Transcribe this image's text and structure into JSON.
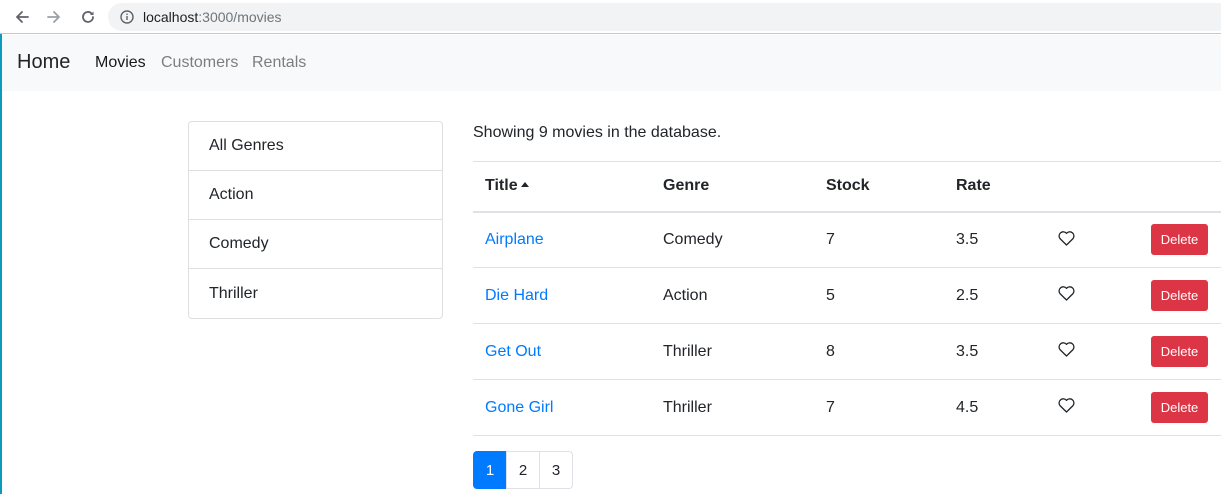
{
  "browser": {
    "url_host": "localhost",
    "url_path": ":3000/movies"
  },
  "navbar": {
    "brand": "Home",
    "links": [
      {
        "label": "Movies",
        "active": true
      },
      {
        "label": "Customers",
        "active": false
      },
      {
        "label": "Rentals",
        "active": false
      }
    ]
  },
  "genres": [
    "All Genres",
    "Action",
    "Comedy",
    "Thriller"
  ],
  "summary": "Showing 9 movies in the database.",
  "table": {
    "headers": {
      "title": "Title",
      "genre": "Genre",
      "stock": "Stock",
      "rate": "Rate"
    },
    "rows": [
      {
        "title": "Airplane",
        "genre": "Comedy",
        "stock": "7",
        "rate": "3.5",
        "delete": "Delete"
      },
      {
        "title": "Die Hard",
        "genre": "Action",
        "stock": "5",
        "rate": "2.5",
        "delete": "Delete"
      },
      {
        "title": "Get Out",
        "genre": "Thriller",
        "stock": "8",
        "rate": "3.5",
        "delete": "Delete"
      },
      {
        "title": "Gone Girl",
        "genre": "Thriller",
        "stock": "7",
        "rate": "4.5",
        "delete": "Delete"
      }
    ]
  },
  "pagination": {
    "pages": [
      "1",
      "2",
      "3"
    ],
    "current": "1"
  },
  "colors": {
    "primary": "#007bff",
    "danger": "#dc3545",
    "navbar_bg": "#f8f9fa"
  },
  "icons": {
    "back": "arrow-left-icon",
    "forward": "arrow-right-icon",
    "reload": "reload-icon",
    "info": "info-icon",
    "like": "heart-outline-icon",
    "sort": "caret-up-icon"
  }
}
